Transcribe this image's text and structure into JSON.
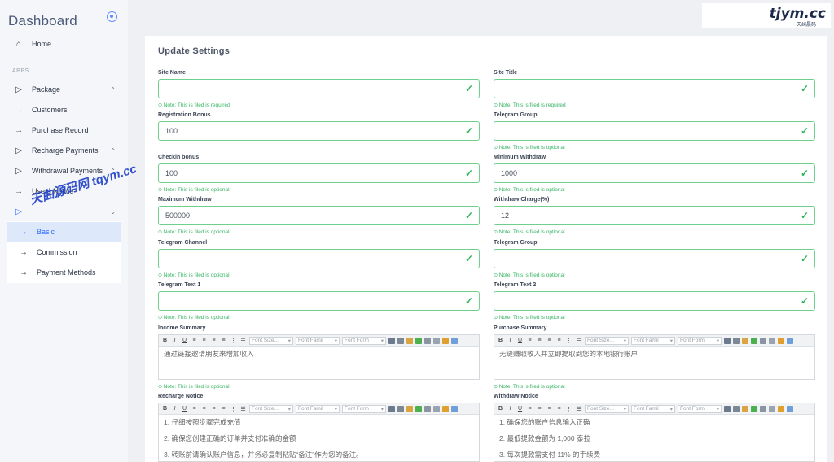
{
  "sidebar": {
    "brand": "Dashboard",
    "section_apps": "APPS",
    "items": [
      {
        "label": "Home",
        "icon": "home-icon"
      },
      {
        "label": "Package",
        "icon": "play-icon"
      },
      {
        "label": "Customers",
        "icon": "arrow-right-icon"
      },
      {
        "label": "Purchase Record",
        "icon": "arrow-right-icon"
      },
      {
        "label": "Recharge Payments",
        "icon": "play-icon"
      },
      {
        "label": "Withdrawal Payments",
        "icon": "play-icon"
      },
      {
        "label": "Users Notice",
        "icon": "arrow-right-icon"
      },
      {
        "label": "Basic",
        "icon": "arrow-right-icon"
      },
      {
        "label": "Commission",
        "icon": "arrow-right-icon"
      },
      {
        "label": "Payment Methods",
        "icon": "arrow-right-icon"
      }
    ]
  },
  "watermark": {
    "logo": "tjym.cc",
    "logo_sub": "天纠晨码",
    "diagonal": "天曲源码网 tqym.cc"
  },
  "card": {
    "title": "Update Settings"
  },
  "fields": {
    "site_name": {
      "label": "Site Name",
      "value": "",
      "note": "Note: This is filed is required"
    },
    "site_title": {
      "label": "Site Title",
      "value": "",
      "note": "Note: This is filed is required"
    },
    "registration_bonus": {
      "label": "Registration Bonus",
      "value": "100",
      "note": "Note: This is filed is optional"
    },
    "telegram_group_1": {
      "label": "Telegram Group",
      "value": "",
      "note": "Note: This is filed is optional"
    },
    "checkin_bonus": {
      "label": "Checkin bonus",
      "value": "100",
      "note": "Note: This is filed is optional"
    },
    "minimum_withdraw": {
      "label": "Minimum Withdraw",
      "value": "1000",
      "note": "Note: This is filed is optional"
    },
    "maximum_withdraw": {
      "label": "Maximum Withdraw",
      "value": "500000",
      "note": "Note: This is filed is optional"
    },
    "withdraw_charge": {
      "label": "Withdraw Charge(%)",
      "value": "12",
      "note": "Note: This is filed is optional"
    },
    "telegram_channel": {
      "label": "Telegram Channel",
      "value": "",
      "note": "Note: This is filed is optional"
    },
    "telegram_group_2": {
      "label": "Telegram Group",
      "value": "",
      "note": "Note: This is filed is optional"
    },
    "telegram_text_1": {
      "label": "Telegram Text 1",
      "value": "",
      "note": "Note: This is filed is optional"
    },
    "telegram_text_2": {
      "label": "Telegram Text 2",
      "value": "",
      "note": "Note: This is filed is optional"
    }
  },
  "editors": {
    "income_summary": {
      "label": "Income Summary",
      "lines": [
        "通过链接邀请朋友来增加收入"
      ],
      "note": "Note: This is filed is optional"
    },
    "purchase_summary": {
      "label": "Purchase Summary",
      "lines": [
        "无缝赚取收入并立即提取到您的本地银行账户"
      ],
      "note": "Note: This is filed is optional"
    },
    "recharge_notice": {
      "label": "Recharge Notice",
      "lines": [
        "1. 仔细按照步骤完成充值",
        "2. 确保您创建正确的订单并支付准确的金额",
        "3. 转账前请确认账户信息，并务必复制粘贴“备注”作为您的备注。"
      ]
    },
    "withdraw_notice": {
      "label": "Withdraw Notice",
      "lines": [
        "1. 确保您的账户信息输入正确",
        "2. 最低提款金额为 1,000 泰拉",
        "3. 每次提款需支付 11% 的手续费"
      ]
    }
  },
  "toolbar": {
    "bold": "B",
    "italic": "I",
    "underline": "U",
    "font_size": "Font Size...",
    "font_family": "Font Famil",
    "font_format": "Font Form"
  },
  "colors": {
    "accent": "#2f6bff",
    "success": "#2fb35a",
    "input_border": "#6fd08e"
  }
}
